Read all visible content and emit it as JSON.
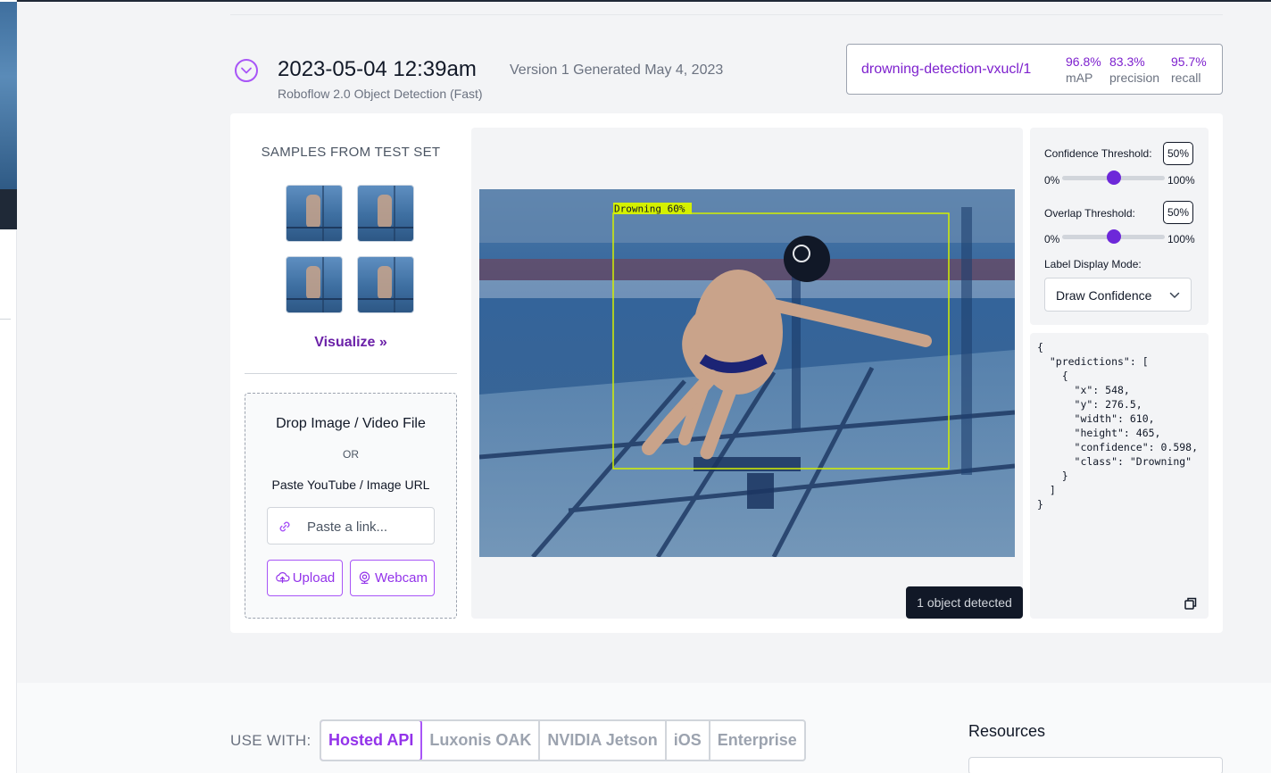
{
  "version": {
    "title": "2023-05-04 12:39am",
    "subtitle": "Version 1 Generated May 4, 2023",
    "model_type": "Roboflow 2.0 Object Detection (Fast)"
  },
  "metrics": {
    "model_id": "drowning-detection-vxucl/1",
    "map_value": "96.8%",
    "map_label": "mAP",
    "precision_value": "83.3%",
    "precision_label": "precision",
    "recall_value": "95.7%",
    "recall_label": "recall"
  },
  "samples": {
    "title": "SAMPLES FROM TEST SET",
    "visualize_label": "Visualize"
  },
  "dropzone": {
    "title": "Drop Image / Video File",
    "or": "OR",
    "paste_label": "Paste YouTube / Image URL",
    "input_placeholder": "Paste a link...",
    "upload_label": "Upload",
    "webcam_label": "Webcam"
  },
  "preview": {
    "box_label": "Drowning 60%",
    "detected_badge": "1 object detected"
  },
  "settings": {
    "confidence_label": "Confidence Threshold:",
    "confidence_value": "50%",
    "confidence_level": 0.5,
    "overlap_label": "Overlap Threshold:",
    "overlap_value": "50%",
    "overlap_level": 0.5,
    "slider_min": "0%",
    "slider_max": "100%",
    "label_mode_label": "Label Display Mode:",
    "label_mode_value": "Draw Confidence"
  },
  "json_output": "{\n  \"predictions\": [\n    {\n      \"x\": 548,\n      \"y\": 276.5,\n      \"width\": 610,\n      \"height\": 465,\n      \"confidence\": 0.598,\n      \"class\": \"Drowning\"\n    }\n  ]\n}",
  "use_with": {
    "label": "USE WITH:",
    "tabs": [
      "Hosted API",
      "Luxonis OAK",
      "NVIDIA Jetson",
      "iOS",
      "Enterprise"
    ],
    "active_tab": "Hosted API"
  },
  "resources": {
    "title": "Resources"
  },
  "colors": {
    "accent": "#9333ea",
    "detection_box": "#d4f000"
  }
}
